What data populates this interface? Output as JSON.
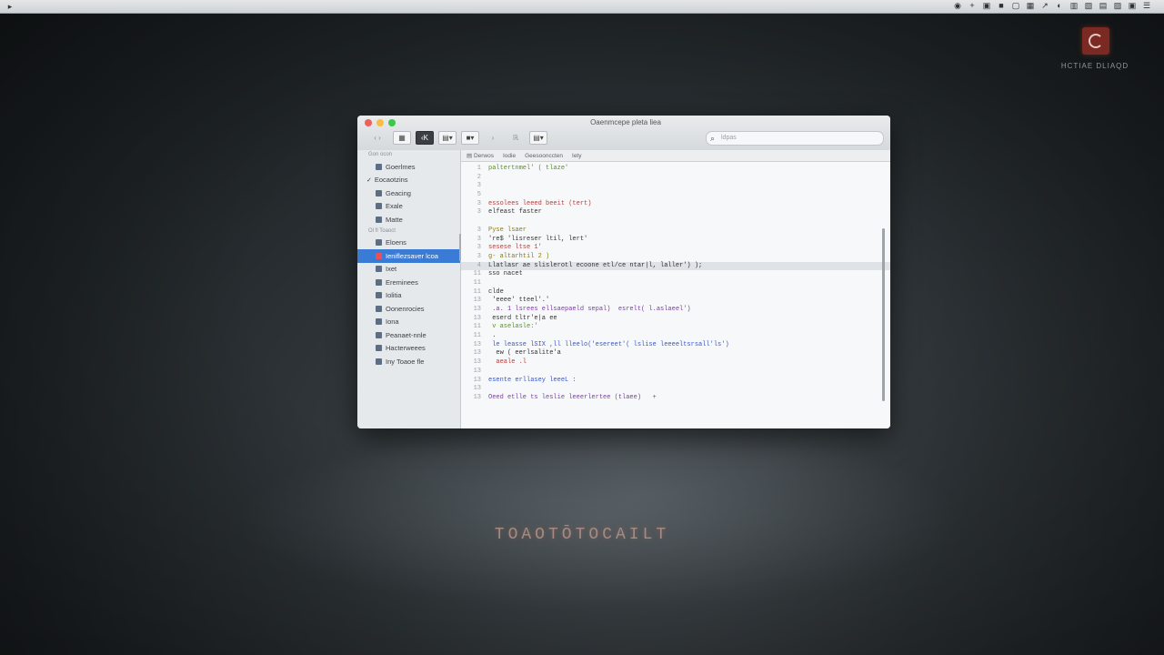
{
  "menubar": {
    "apple": "▸",
    "status_icons": [
      "◉",
      "+",
      "▣",
      "■",
      "▢",
      "▦",
      "↗",
      "◐",
      "▥",
      "▧",
      "▤",
      "▨",
      "▣",
      "☰"
    ]
  },
  "corner": {
    "tag": "HCTIAE DLIAQD"
  },
  "window": {
    "title": "Oaenmcepe pleta liea",
    "toolbar": {
      "b1": "▦",
      "b2": "‹K",
      "b3": "▤▾",
      "b4": "■▾",
      "b5": "›",
      "b6": "ℝ",
      "b7": "▤▾"
    },
    "search": {
      "icon": "⌕",
      "placeholder": "ldpas"
    }
  },
  "sidebar": {
    "header": "Gon ocon",
    "items": [
      {
        "label": "Goerlmes",
        "type": "item"
      },
      {
        "label": "Eocaotzins",
        "type": "check"
      },
      {
        "label": "Geacing",
        "type": "item"
      },
      {
        "label": "Exale",
        "type": "item"
      },
      {
        "label": "Matte",
        "type": "item"
      }
    ],
    "subheader": "Ol fl Toaoct",
    "items2": [
      {
        "label": "Eloens",
        "selected": false
      },
      {
        "label": "Ieniflezsaver lcoa",
        "selected": true
      },
      {
        "label": "Ixet",
        "selected": false
      },
      {
        "label": "Ereminees",
        "selected": false
      },
      {
        "label": "Iolitia",
        "selected": false
      },
      {
        "label": "Oonenrocies",
        "selected": false
      },
      {
        "label": "Iona",
        "selected": false
      },
      {
        "label": "Peanaet-nnle",
        "selected": false
      },
      {
        "label": "Hacterweees",
        "selected": false
      },
      {
        "label": "Iny Toaoe fle",
        "selected": false
      }
    ]
  },
  "editor": {
    "tabs": [
      "▤ Derwos",
      "Iodie",
      "Geesoonccten",
      "Iety"
    ],
    "lines": [
      {
        "n": "1",
        "t": "paltertnmel' ( tlaze'",
        "c": "c-green"
      },
      {
        "n": "2",
        "t": "",
        "c": ""
      },
      {
        "n": "3",
        "t": "",
        "c": ""
      },
      {
        "n": "5",
        "t": "",
        "c": ""
      },
      {
        "n": "3",
        "t": "essolees leeed beeit (tert)",
        "c": "c-red"
      },
      {
        "n": "3",
        "t": "elfeast faster",
        "c": "c-dark"
      },
      {
        "n": "",
        "t": "",
        "c": ""
      },
      {
        "n": "3",
        "t": "Pyse lsaer",
        "c": "c-olive"
      },
      {
        "n": "3",
        "t": "'re$ 'lisreser ltil, lert'",
        "c": "c-dark"
      },
      {
        "n": "3",
        "t": "sesese ltse 1'",
        "c": "c-red"
      },
      {
        "n": "3",
        "t": "g- altarhtil 2 )",
        "c": "c-olive"
      },
      {
        "n": "4",
        "t": "Llatlasr ae slislerotl ecoone etl/ce ntar|l, laller') );",
        "c": "c-dark",
        "hl": true
      },
      {
        "n": "11",
        "t": "sso nacet",
        "c": "c-dark"
      },
      {
        "n": "11",
        "t": "",
        "c": ""
      },
      {
        "n": "11",
        "t": "clde",
        "c": "c-dark"
      },
      {
        "n": "13",
        "t": " 'eeee' tteel'.'",
        "c": "c-dark"
      },
      {
        "n": "13",
        "t": " .a. 1 lsrees ellsaepaeld sepal)  esrelt( l.aslaeel')",
        "c": "c-purple"
      },
      {
        "n": "13",
        "t": " eserd tltr'e|a ee",
        "c": "c-dark"
      },
      {
        "n": "11",
        "t": " v aselasle:'",
        "c": "c-green"
      },
      {
        "n": "11",
        "t": " .",
        "c": "c-dark"
      },
      {
        "n": "13",
        "t": " le leasse lSIX ,ll lleelo('esereet'( lslise leeeeltsrsall'ls')",
        "c": "c-blue"
      },
      {
        "n": "13",
        "t": "  ew ( eerlsalite'a",
        "c": "c-dark"
      },
      {
        "n": "13",
        "t": "  aeale .l",
        "c": "c-red"
      },
      {
        "n": "13",
        "t": "",
        "c": ""
      },
      {
        "n": "13",
        "t": "esente erllasey leeeL :",
        "c": "c-blue"
      },
      {
        "n": "13",
        "t": "",
        "c": ""
      },
      {
        "n": "13",
        "t": "Oeed etlle ts leslie leeerlertee (tlaee)   +",
        "c": "c-purple"
      }
    ]
  },
  "caption": "TOAOTŌTOCAILT"
}
